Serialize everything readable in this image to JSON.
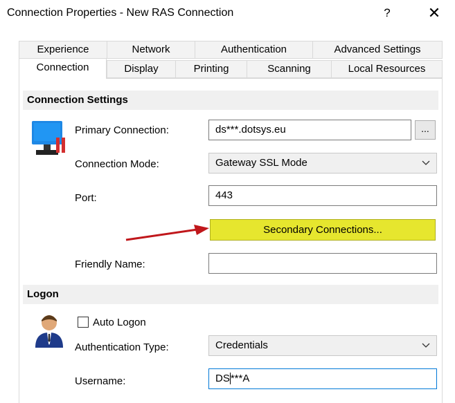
{
  "window": {
    "title": "Connection Properties - New RAS Connection",
    "help_label": "?",
    "close_label": "✕"
  },
  "tabs_row1": [
    {
      "label": "Experience"
    },
    {
      "label": "Network"
    },
    {
      "label": "Authentication"
    },
    {
      "label": "Advanced Settings"
    }
  ],
  "tabs_row2": [
    {
      "label": "Connection",
      "active": true
    },
    {
      "label": "Display"
    },
    {
      "label": "Printing"
    },
    {
      "label": "Scanning"
    },
    {
      "label": "Local Resources"
    }
  ],
  "connection_settings": {
    "heading": "Connection Settings",
    "primary_connection_label": "Primary Connection:",
    "primary_connection_value": "ds***.dotsys.eu",
    "browse_label": "...",
    "connection_mode_label": "Connection Mode:",
    "connection_mode_value": "Gateway SSL Mode",
    "port_label": "Port:",
    "port_value": "443",
    "secondary_connections_label": "Secondary Connections...",
    "friendly_name_label": "Friendly Name:",
    "friendly_name_value": ""
  },
  "logon": {
    "heading": "Logon",
    "auto_logon_label": "Auto Logon",
    "auto_logon_checked": false,
    "auth_type_label": "Authentication Type:",
    "auth_type_value": "Credentials",
    "username_label": "Username:",
    "username_prefix": "DS",
    "username_suffix": "***A"
  },
  "colors": {
    "highlight_button": "#e6e62e",
    "arrow": "#c0171b",
    "focus_border": "#0078d7"
  },
  "icons": {
    "connection": "monitor-connection-icon",
    "logon": "user-icon",
    "annotation": "red-arrow-icon"
  }
}
